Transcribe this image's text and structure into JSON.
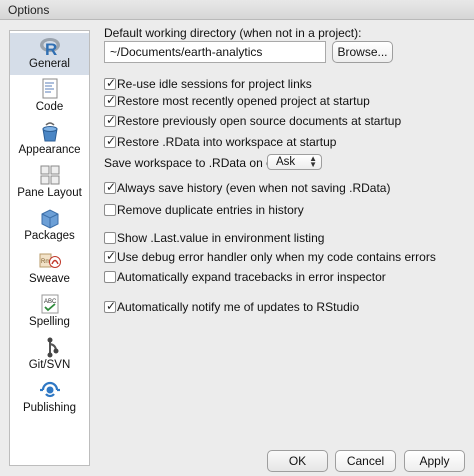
{
  "window": {
    "title": "Options"
  },
  "sidebar": {
    "items": [
      {
        "label": "General",
        "icon": "r-logo-icon",
        "selected": true
      },
      {
        "label": "Code",
        "icon": "code-file-icon",
        "selected": false
      },
      {
        "label": "Appearance",
        "icon": "paint-bucket-icon",
        "selected": false
      },
      {
        "label": "Pane Layout",
        "icon": "pane-grid-icon",
        "selected": false
      },
      {
        "label": "Packages",
        "icon": "package-box-icon",
        "selected": false
      },
      {
        "label": "Sweave",
        "icon": "sweave-pdf-icon",
        "selected": false
      },
      {
        "label": "Spelling",
        "icon": "spellcheck-abc-icon",
        "selected": false
      },
      {
        "label": "Git/SVN",
        "icon": "git-svn-icon",
        "selected": false
      },
      {
        "label": "Publishing",
        "icon": "publish-icon",
        "selected": false
      }
    ]
  },
  "general": {
    "working_dir_label": "Default working directory (when not in a project):",
    "working_dir_value": "~/Documents/earth-analytics",
    "browse_label": "Browse...",
    "save_workspace_label": "Save workspace to .RData on exit:",
    "save_workspace_value": "Ask",
    "options": [
      {
        "label": "Re-use idle sessions for project links",
        "checked": true
      },
      {
        "label": "Restore most recently opened project at startup",
        "checked": true
      },
      {
        "label": "Restore previously open source documents at startup",
        "checked": true
      },
      {
        "label": "Restore .RData into workspace at startup",
        "checked": true
      },
      {
        "label": "Always save history (even when not saving .RData)",
        "checked": true
      },
      {
        "label": "Remove duplicate entries in history",
        "checked": false
      },
      {
        "label": "Show .Last.value in environment listing",
        "checked": false
      },
      {
        "label": "Use debug error handler only when my code contains errors",
        "checked": true
      },
      {
        "label": "Automatically expand tracebacks in error inspector",
        "checked": false
      },
      {
        "label": "Automatically notify me of updates to RStudio",
        "checked": true
      }
    ]
  },
  "footer": {
    "ok_label": "OK",
    "cancel_label": "Cancel",
    "apply_label": "Apply"
  },
  "colors": {
    "selected_bg": "#d5dde8",
    "window_bg": "#ececec"
  }
}
